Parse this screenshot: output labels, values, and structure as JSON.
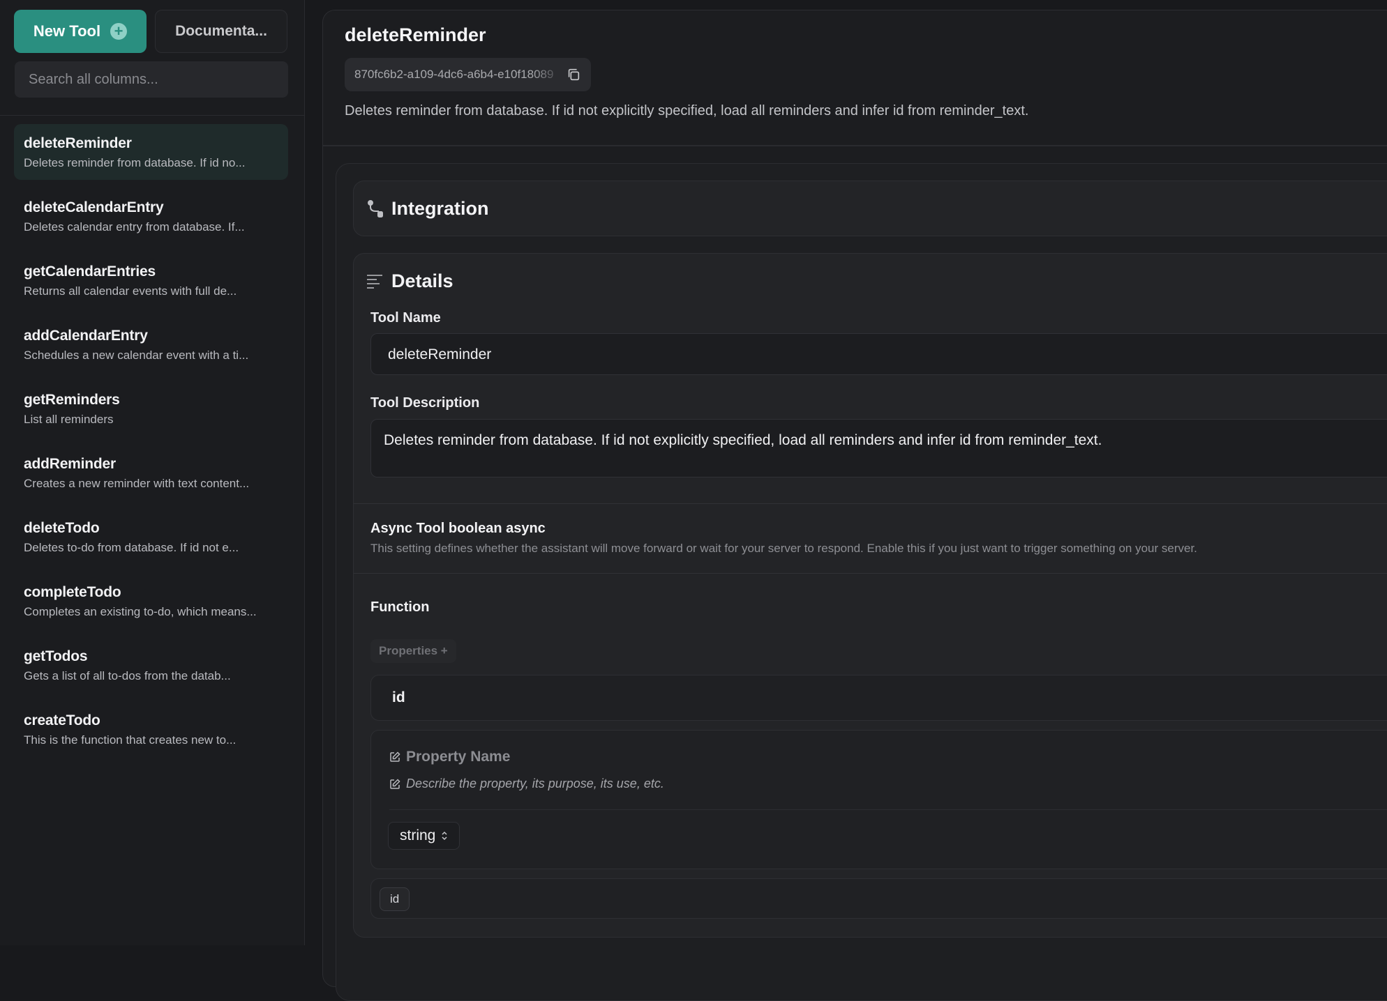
{
  "sidebar": {
    "new_tool_label": "New Tool",
    "docs_label": "Documenta...",
    "search_placeholder": "Search all columns...",
    "items": [
      {
        "name": "deleteReminder",
        "desc": "Deletes reminder from database. If id no..."
      },
      {
        "name": "deleteCalendarEntry",
        "desc": "Deletes calendar entry from database. If..."
      },
      {
        "name": "getCalendarEntries",
        "desc": "Returns all calendar events with full de..."
      },
      {
        "name": "addCalendarEntry",
        "desc": "Schedules a new calendar event with a ti..."
      },
      {
        "name": "getReminders",
        "desc": "List all reminders"
      },
      {
        "name": "addReminder",
        "desc": "Creates a new reminder with text content..."
      },
      {
        "name": "deleteTodo",
        "desc": "Deletes to-do from database. If id not e..."
      },
      {
        "name": "completeTodo",
        "desc": "Completes an existing to-do, which means..."
      },
      {
        "name": "getTodos",
        "desc": "Gets a list of all to-dos from the datab..."
      },
      {
        "name": "createTodo",
        "desc": "This is the function that creates new to..."
      }
    ]
  },
  "header": {
    "title": "deleteReminder",
    "id": "870fc6b2-a109-4dc6-a6b4-e10f18089",
    "description": "Deletes reminder from database. If id not explicitly specified, load all reminders and infer id from reminder_text."
  },
  "integration": {
    "title": "Integration"
  },
  "details": {
    "title": "Details",
    "tool_name_label": "Tool Name",
    "tool_name_value": "deleteReminder",
    "tool_desc_label": "Tool Description",
    "tool_desc_value": "Deletes reminder from database. If id not explicitly specified, load all reminders and infer id from reminder_text.",
    "async_title": "Async Tool boolean async",
    "async_desc": "This setting defines whether the assistant will move forward or wait for your server to respond. Enable this if you just want to trigger something on your server.",
    "function_title": "Function",
    "properties_label": "Properties +",
    "property_id": "id",
    "property_name_placeholder": "Property Name",
    "property_desc_placeholder": "Describe the property, its purpose, its use, etc.",
    "property_type": "string",
    "required_chip": "id"
  },
  "colors": {
    "accent": "#2a8f80",
    "background": "#18191c"
  },
  "icons": [
    "plus-circle-icon",
    "copy-icon",
    "integration-icon",
    "details-lines-icon",
    "edit-icon",
    "chevron-updown-icon"
  ]
}
